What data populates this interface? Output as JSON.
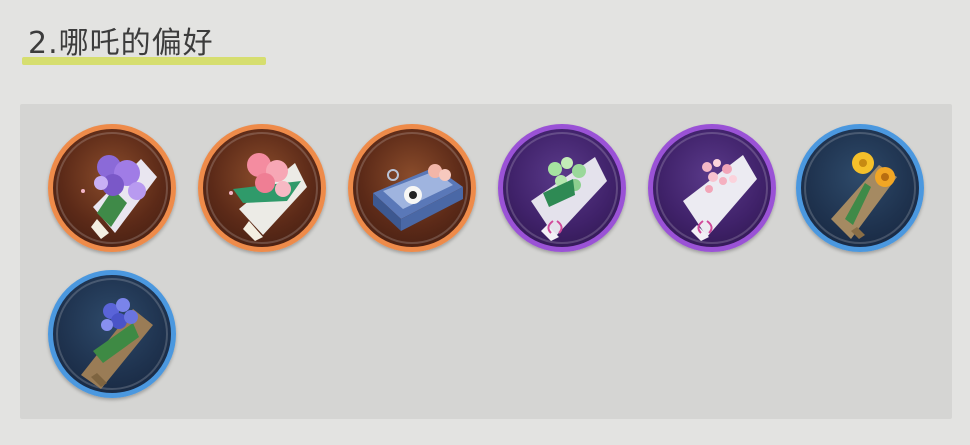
{
  "section": {
    "title": "2.哪吒的偏好"
  },
  "colors": {
    "underline": "#d6de6f",
    "rarity_orange": "#ee8b4a",
    "rarity_purple": "#9a52d6",
    "rarity_blue": "#4b98df"
  },
  "gifts": [
    {
      "icon": "purple-flower-bouquet-icon",
      "rarity": "orange"
    },
    {
      "icon": "pink-carnation-bouquet-icon",
      "rarity": "orange"
    },
    {
      "icon": "gift-box-icon",
      "rarity": "orange"
    },
    {
      "icon": "green-bud-bouquet-icon",
      "rarity": "purple"
    },
    {
      "icon": "pink-blossom-bouquet-icon",
      "rarity": "purple"
    },
    {
      "icon": "yellow-flower-bouquet-icon",
      "rarity": "blue"
    },
    {
      "icon": "blue-flower-bouquet-icon",
      "rarity": "blue"
    }
  ]
}
